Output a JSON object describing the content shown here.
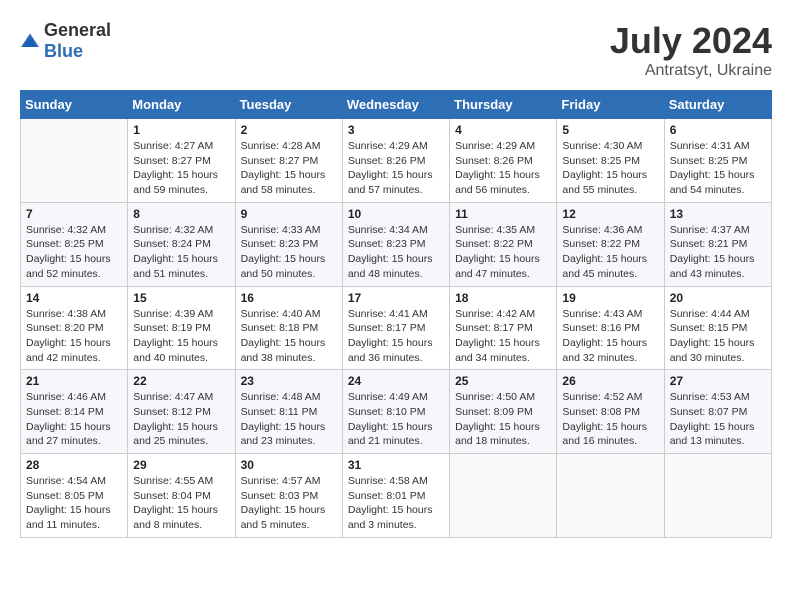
{
  "header": {
    "logo_general": "General",
    "logo_blue": "Blue",
    "month_year": "July 2024",
    "location": "Antratsyt, Ukraine"
  },
  "days_of_week": [
    "Sunday",
    "Monday",
    "Tuesday",
    "Wednesday",
    "Thursday",
    "Friday",
    "Saturday"
  ],
  "weeks": [
    [
      {
        "day": "",
        "info": ""
      },
      {
        "day": "1",
        "info": "Sunrise: 4:27 AM\nSunset: 8:27 PM\nDaylight: 15 hours\nand 59 minutes."
      },
      {
        "day": "2",
        "info": "Sunrise: 4:28 AM\nSunset: 8:27 PM\nDaylight: 15 hours\nand 58 minutes."
      },
      {
        "day": "3",
        "info": "Sunrise: 4:29 AM\nSunset: 8:26 PM\nDaylight: 15 hours\nand 57 minutes."
      },
      {
        "day": "4",
        "info": "Sunrise: 4:29 AM\nSunset: 8:26 PM\nDaylight: 15 hours\nand 56 minutes."
      },
      {
        "day": "5",
        "info": "Sunrise: 4:30 AM\nSunset: 8:25 PM\nDaylight: 15 hours\nand 55 minutes."
      },
      {
        "day": "6",
        "info": "Sunrise: 4:31 AM\nSunset: 8:25 PM\nDaylight: 15 hours\nand 54 minutes."
      }
    ],
    [
      {
        "day": "7",
        "info": "Sunrise: 4:32 AM\nSunset: 8:25 PM\nDaylight: 15 hours\nand 52 minutes."
      },
      {
        "day": "8",
        "info": "Sunrise: 4:32 AM\nSunset: 8:24 PM\nDaylight: 15 hours\nand 51 minutes."
      },
      {
        "day": "9",
        "info": "Sunrise: 4:33 AM\nSunset: 8:23 PM\nDaylight: 15 hours\nand 50 minutes."
      },
      {
        "day": "10",
        "info": "Sunrise: 4:34 AM\nSunset: 8:23 PM\nDaylight: 15 hours\nand 48 minutes."
      },
      {
        "day": "11",
        "info": "Sunrise: 4:35 AM\nSunset: 8:22 PM\nDaylight: 15 hours\nand 47 minutes."
      },
      {
        "day": "12",
        "info": "Sunrise: 4:36 AM\nSunset: 8:22 PM\nDaylight: 15 hours\nand 45 minutes."
      },
      {
        "day": "13",
        "info": "Sunrise: 4:37 AM\nSunset: 8:21 PM\nDaylight: 15 hours\nand 43 minutes."
      }
    ],
    [
      {
        "day": "14",
        "info": "Sunrise: 4:38 AM\nSunset: 8:20 PM\nDaylight: 15 hours\nand 42 minutes."
      },
      {
        "day": "15",
        "info": "Sunrise: 4:39 AM\nSunset: 8:19 PM\nDaylight: 15 hours\nand 40 minutes."
      },
      {
        "day": "16",
        "info": "Sunrise: 4:40 AM\nSunset: 8:18 PM\nDaylight: 15 hours\nand 38 minutes."
      },
      {
        "day": "17",
        "info": "Sunrise: 4:41 AM\nSunset: 8:17 PM\nDaylight: 15 hours\nand 36 minutes."
      },
      {
        "day": "18",
        "info": "Sunrise: 4:42 AM\nSunset: 8:17 PM\nDaylight: 15 hours\nand 34 minutes."
      },
      {
        "day": "19",
        "info": "Sunrise: 4:43 AM\nSunset: 8:16 PM\nDaylight: 15 hours\nand 32 minutes."
      },
      {
        "day": "20",
        "info": "Sunrise: 4:44 AM\nSunset: 8:15 PM\nDaylight: 15 hours\nand 30 minutes."
      }
    ],
    [
      {
        "day": "21",
        "info": "Sunrise: 4:46 AM\nSunset: 8:14 PM\nDaylight: 15 hours\nand 27 minutes."
      },
      {
        "day": "22",
        "info": "Sunrise: 4:47 AM\nSunset: 8:12 PM\nDaylight: 15 hours\nand 25 minutes."
      },
      {
        "day": "23",
        "info": "Sunrise: 4:48 AM\nSunset: 8:11 PM\nDaylight: 15 hours\nand 23 minutes."
      },
      {
        "day": "24",
        "info": "Sunrise: 4:49 AM\nSunset: 8:10 PM\nDaylight: 15 hours\nand 21 minutes."
      },
      {
        "day": "25",
        "info": "Sunrise: 4:50 AM\nSunset: 8:09 PM\nDaylight: 15 hours\nand 18 minutes."
      },
      {
        "day": "26",
        "info": "Sunrise: 4:52 AM\nSunset: 8:08 PM\nDaylight: 15 hours\nand 16 minutes."
      },
      {
        "day": "27",
        "info": "Sunrise: 4:53 AM\nSunset: 8:07 PM\nDaylight: 15 hours\nand 13 minutes."
      }
    ],
    [
      {
        "day": "28",
        "info": "Sunrise: 4:54 AM\nSunset: 8:05 PM\nDaylight: 15 hours\nand 11 minutes."
      },
      {
        "day": "29",
        "info": "Sunrise: 4:55 AM\nSunset: 8:04 PM\nDaylight: 15 hours\nand 8 minutes."
      },
      {
        "day": "30",
        "info": "Sunrise: 4:57 AM\nSunset: 8:03 PM\nDaylight: 15 hours\nand 5 minutes."
      },
      {
        "day": "31",
        "info": "Sunrise: 4:58 AM\nSunset: 8:01 PM\nDaylight: 15 hours\nand 3 minutes."
      },
      {
        "day": "",
        "info": ""
      },
      {
        "day": "",
        "info": ""
      },
      {
        "day": "",
        "info": ""
      }
    ]
  ]
}
